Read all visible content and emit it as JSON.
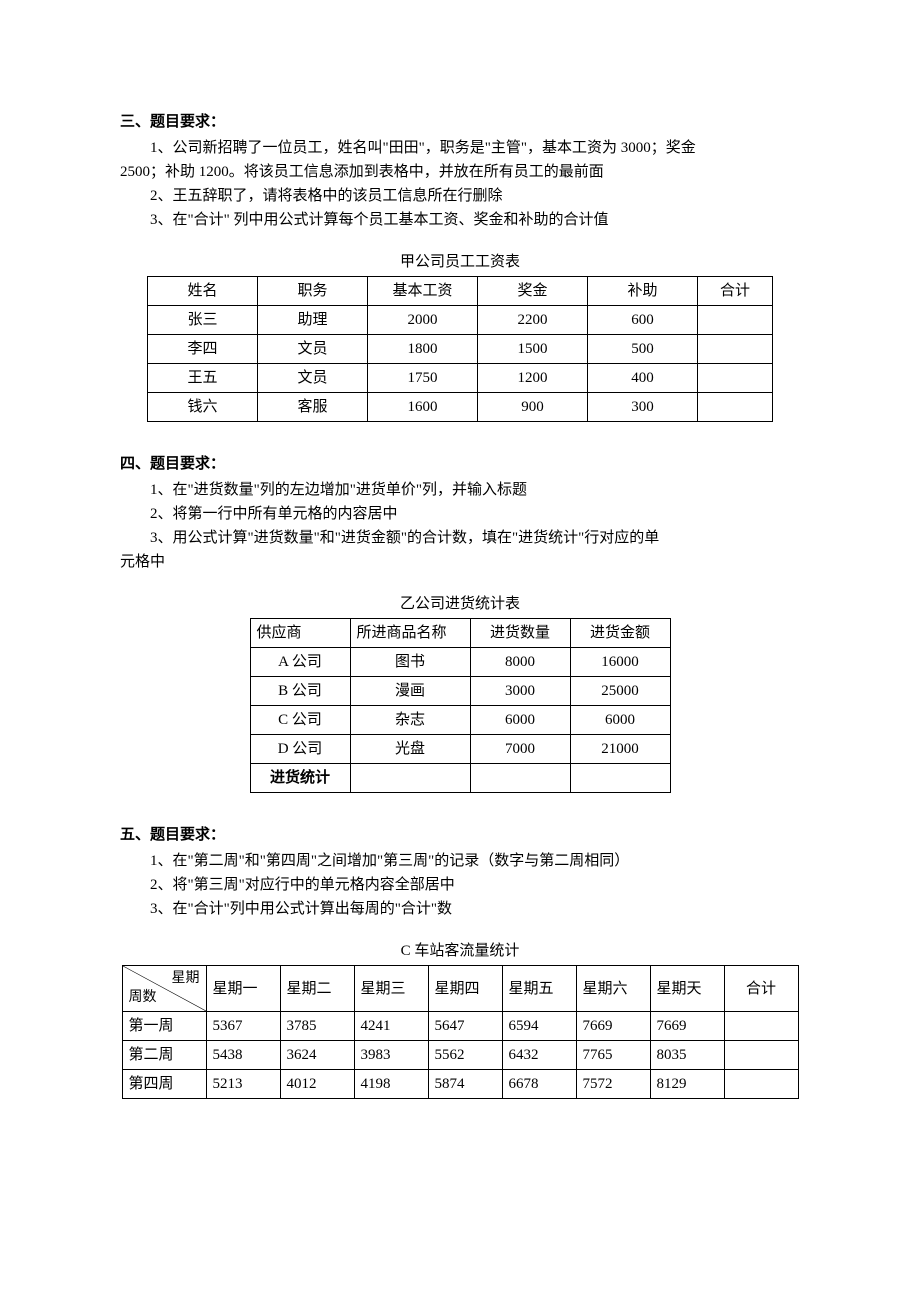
{
  "section3": {
    "title": "三、题目要求：",
    "item1": "1、公司新招聘了一位员工，姓名叫\"田田\"，职务是\"主管\"，基本工资为 3000；奖金",
    "item1b": "2500；补助 1200。将该员工信息添加到表格中，并放在所有员工的最前面",
    "item2": "2、王五辞职了，请将表格中的该员工信息所在行删除",
    "item3": "3、在\"合计\" 列中用公式计算每个员工基本工资、奖金和补助的合计值",
    "tableTitle": "甲公司员工工资表",
    "headers": [
      "姓名",
      "职务",
      "基本工资",
      "奖金",
      "补助",
      "合计"
    ],
    "rows": [
      [
        "张三",
        "助理",
        "2000",
        "2200",
        "600",
        ""
      ],
      [
        "李四",
        "文员",
        "1800",
        "1500",
        "500",
        ""
      ],
      [
        "王五",
        "文员",
        "1750",
        "1200",
        "400",
        ""
      ],
      [
        "钱六",
        "客服",
        "1600",
        "900",
        "300",
        ""
      ]
    ]
  },
  "section4": {
    "title": "四、题目要求：",
    "item1": "1、在\"进货数量\"列的左边增加\"进货单价\"列，并输入标题",
    "item2": "2、将第一行中所有单元格的内容居中",
    "item3": "3、用公式计算\"进货数量\"和\"进货金额\"的合计数，填在\"进货统计\"行对应的单",
    "item3b": "元格中",
    "tableTitle": "乙公司进货统计表",
    "headers": [
      "供应商",
      "所进商品名称",
      "进货数量",
      "进货金额"
    ],
    "rows": [
      [
        "A 公司",
        "图书",
        "8000",
        "16000"
      ],
      [
        "B 公司",
        "漫画",
        "3000",
        "25000"
      ],
      [
        "C 公司",
        "杂志",
        "6000",
        "6000"
      ],
      [
        "D 公司",
        "光盘",
        "7000",
        "21000"
      ]
    ],
    "footer": [
      "进货统计",
      "",
      "",
      ""
    ]
  },
  "section5": {
    "title": "五、题目要求：",
    "item1": "1、在\"第二周\"和\"第四周\"之间增加\"第三周\"的记录（数字与第二周相同）",
    "item2": "2、将\"第三周\"对应行中的单元格内容全部居中",
    "item3": "3、在\"合计\"列中用公式计算出每周的\"合计\"数",
    "tableTitle": "C 车站客流量统计",
    "diagTop": "星期",
    "diagBottom": "周数",
    "headers": [
      "星期一",
      "星期二",
      "星期三",
      "星期四",
      "星期五",
      "星期六",
      "星期天",
      "合计"
    ],
    "rows": [
      [
        "第一周",
        "5367",
        "3785",
        "4241",
        "5647",
        "6594",
        "7669",
        "7669",
        ""
      ],
      [
        "第二周",
        "5438",
        "3624",
        "3983",
        "5562",
        "6432",
        "7765",
        "8035",
        ""
      ],
      [
        "第四周",
        "5213",
        "4012",
        "4198",
        "5874",
        "6678",
        "7572",
        "8129",
        ""
      ]
    ]
  }
}
